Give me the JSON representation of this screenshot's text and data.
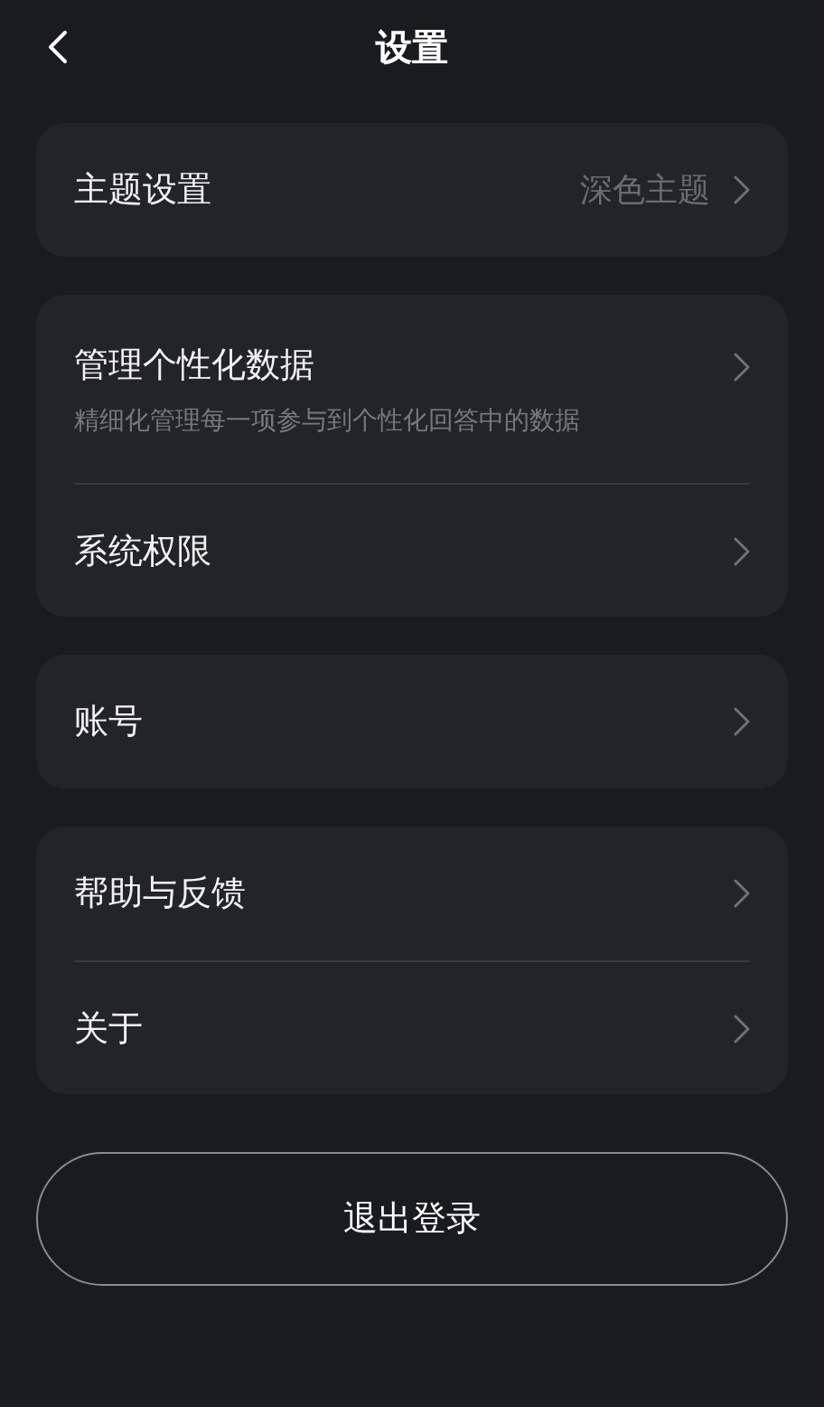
{
  "header": {
    "title": "设置"
  },
  "groups": [
    {
      "items": [
        {
          "label": "主题设置",
          "value": "深色主题"
        }
      ]
    },
    {
      "items": [
        {
          "label": "管理个性化数据",
          "description": "精细化管理每一项参与到个性化回答中的数据"
        },
        {
          "label": "系统权限"
        }
      ]
    },
    {
      "items": [
        {
          "label": "账号"
        }
      ]
    },
    {
      "items": [
        {
          "label": "帮助与反馈"
        },
        {
          "label": "关于"
        }
      ]
    }
  ],
  "logout_button": "退出登录"
}
